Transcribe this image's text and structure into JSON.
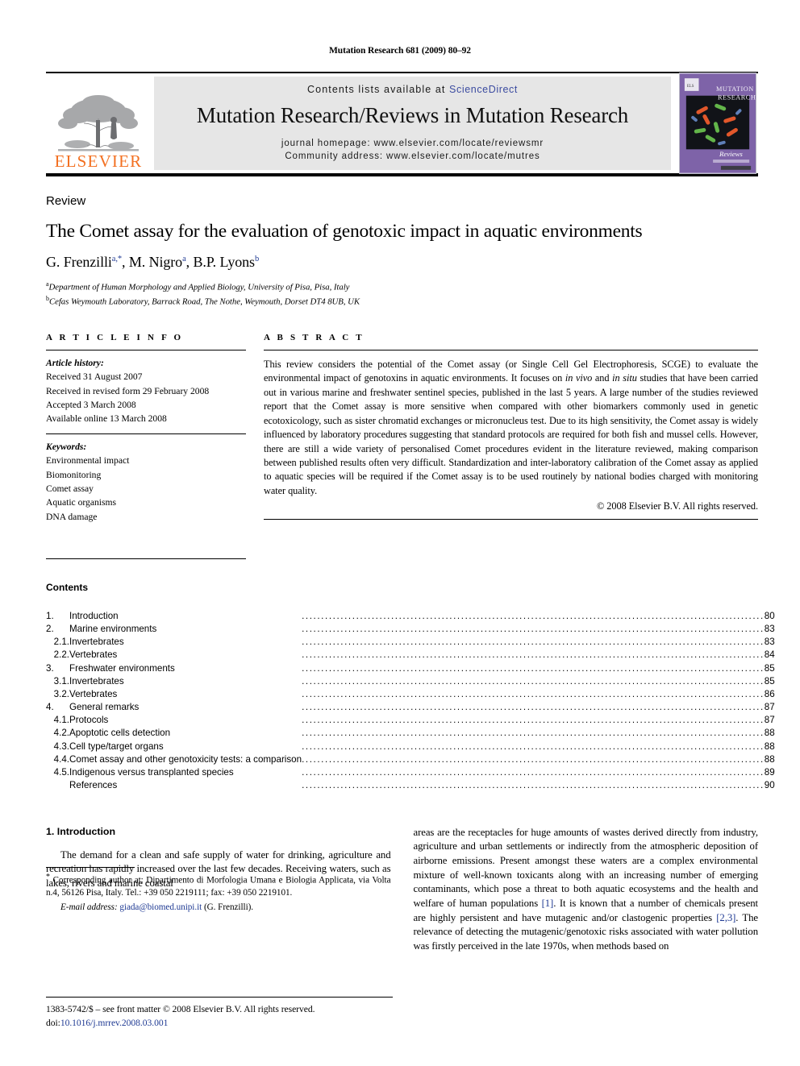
{
  "running_head": "Mutation Research 681 (2009) 80–92",
  "masthead": {
    "publisher_name": "ELSEVIER",
    "contents_prefix": "Contents lists available at",
    "sciencedirect": "ScienceDirect",
    "journal_title": "Mutation Research/Reviews in Mutation Research",
    "homepage": "journal homepage: www.elsevier.com/locate/reviewsmr",
    "community": "Community address: www.elsevier.com/locate/mutres",
    "cover_title_line1": "MUTATION",
    "cover_title_line2": "RESEARCH",
    "cover_sub": "Reviews",
    "sciencedirect_color": "#3b4ba0",
    "elsevier_orange": "#F37021",
    "cover_purple": "#7e63a8"
  },
  "article": {
    "doctype": "Review",
    "title": "The Comet assay for the evaluation of genotoxic impact in aquatic environments",
    "authors": [
      {
        "name": "G. Frenzilli",
        "sup": "a,*"
      },
      {
        "name": "M. Nigro",
        "sup": "a"
      },
      {
        "name": "B.P. Lyons",
        "sup": "b"
      }
    ],
    "affiliations": [
      {
        "sup": "a",
        "text": "Department of Human Morphology and Applied Biology, University of Pisa, Pisa, Italy"
      },
      {
        "sup": "b",
        "text": "Cefas Weymouth Laboratory, Barrack Road, The Nothe, Weymouth, Dorset DT4 8UB, UK"
      }
    ]
  },
  "article_info": {
    "heading": "A R T I C L E   I N F O",
    "history_label": "Article history:",
    "history": [
      "Received 31 August 2007",
      "Received in revised form 29 February 2008",
      "Accepted 3 March 2008",
      "Available online 13 March 2008"
    ],
    "keywords_label": "Keywords:",
    "keywords": [
      "Environmental impact",
      "Biomonitoring",
      "Comet assay",
      "Aquatic organisms",
      "DNA damage"
    ]
  },
  "abstract": {
    "heading": "A B S T R A C T",
    "p1": "This review considers the potential of the Comet assay (or Single Cell Gel Electrophoresis, SCGE) to evaluate the environmental impact of genotoxins in aquatic environments. It focuses on ",
    "italic1": "in vivo",
    "p2": " and ",
    "italic2": "in situ",
    "p3": " studies that have been carried out in various marine and freshwater sentinel species, published in the last 5 years. A large number of the studies reviewed report that the Comet assay is more sensitive when compared with other biomarkers commonly used in genetic ecotoxicology, such as sister chromatid exchanges or micronucleus test. Due to its high sensitivity, the Comet assay is widely influenced by laboratory procedures suggesting that standard protocols are required for both fish and mussel cells. However, there are still a wide variety of personalised Comet procedures evident in the literature reviewed, making comparison between published results often very difficult. Standardization and inter-laboratory calibration of the Comet assay as applied to aquatic species will be required if the Comet assay is to be used routinely by national bodies charged with monitoring water quality.",
    "copyright": "© 2008 Elsevier B.V. All rights reserved."
  },
  "contents": {
    "heading": "Contents",
    "entries": [
      {
        "num": "1.",
        "sub": "",
        "label": "Introduction",
        "page": "80"
      },
      {
        "num": "2.",
        "sub": "",
        "label": "Marine environments",
        "page": "83"
      },
      {
        "num": "",
        "sub": "2.1.",
        "label": "Invertebrates",
        "page": "83"
      },
      {
        "num": "",
        "sub": "2.2.",
        "label": "Vertebrates",
        "page": "84"
      },
      {
        "num": "3.",
        "sub": "",
        "label": "Freshwater environments",
        "page": "85"
      },
      {
        "num": "",
        "sub": "3.1.",
        "label": "Invertebrates",
        "page": "85"
      },
      {
        "num": "",
        "sub": "3.2.",
        "label": "Vertebrates",
        "page": "86"
      },
      {
        "num": "4.",
        "sub": "",
        "label": "General remarks",
        "page": "87"
      },
      {
        "num": "",
        "sub": "4.1.",
        "label": "Protocols",
        "page": "87"
      },
      {
        "num": "",
        "sub": "4.2.",
        "label": "Apoptotic cells detection",
        "page": "88"
      },
      {
        "num": "",
        "sub": "4.3.",
        "label": "Cell type/target organs",
        "page": "88"
      },
      {
        "num": "",
        "sub": "4.4.",
        "label": "Comet assay and other genotoxicity tests: a comparison",
        "page": "88"
      },
      {
        "num": "",
        "sub": "4.5.",
        "label": "Indigenous versus transplanted species",
        "page": "89"
      },
      {
        "num": "",
        "sub": "",
        "label": "References",
        "page": "90"
      }
    ]
  },
  "introduction": {
    "heading": "1. Introduction",
    "left_para": "The demand for a clean and safe supply of water for drinking, agriculture and recreation has rapidly increased over the last few decades. Receiving waters, such as lakes, rivers and marine coastal",
    "right_part1": "areas are the receptacles for huge amounts of wastes derived directly from industry, agriculture and urban settlements or indirectly from the atmospheric deposition of airborne emissions. Present amongst these waters are a complex environmental mixture of well-known toxicants along with an increasing number of emerging contaminants, which pose a threat to both aquatic ecosystems and the health and welfare of human populations ",
    "ref1": "[1]",
    "right_part2": ". It is known that a number of chemicals present are highly persistent and have mutagenic and/or clastogenic properties ",
    "ref2": "[2,3]",
    "right_part3": ". The relevance of detecting the mutagenic/genotoxic risks associated with water pollution was firstly perceived in the late 1970s, when methods based on"
  },
  "footnote": {
    "star": "*",
    "corresponding": " Corresponding author at: Dipartimento di Morfologia Umana e Biologia Applicata, via Volta n.4, 56126 Pisa, Italy. Tel.: +39 050 2219111; fax: +39 050 2219101.",
    "email_label": "E-mail address:",
    "email": "giada@biomed.unipi.it",
    "email_suffix": " (G. Frenzilli)."
  },
  "footer": {
    "issn_line": "1383-5742/$ – see front matter © 2008 Elsevier B.V. All rights reserved.",
    "doi_label": "doi:",
    "doi_value": "10.1016/j.mrrev.2008.03.001"
  }
}
